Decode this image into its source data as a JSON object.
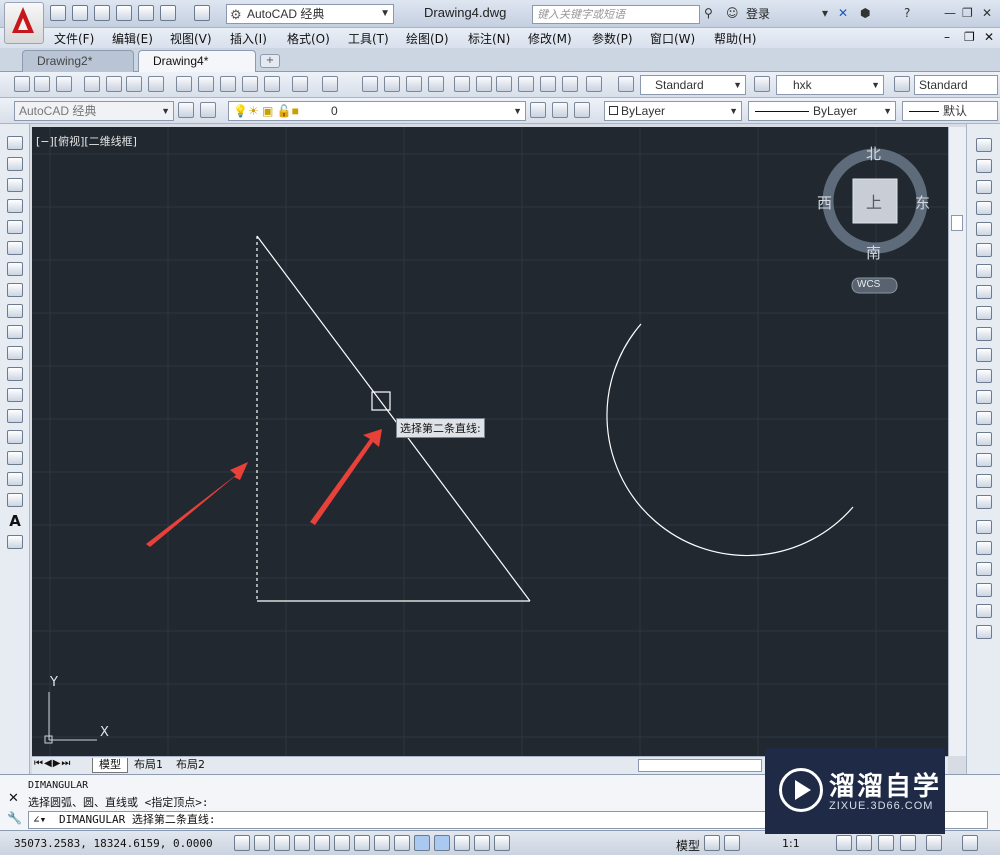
{
  "titlebar": {
    "workspace": "AutoCAD 经典",
    "document_title": "Drawing4.dwg",
    "search_placeholder": "键入关键字或短语",
    "login_label": "登录"
  },
  "menu": [
    "文件(F)",
    "编辑(E)",
    "视图(V)",
    "插入(I)",
    "格式(O)",
    "工具(T)",
    "绘图(D)",
    "标注(N)",
    "修改(M)",
    "参数(P)",
    "窗口(W)",
    "帮助(H)"
  ],
  "tabs": [
    "Drawing2*",
    "Drawing4*"
  ],
  "toolbar": {
    "text_style": "Standard",
    "dim_style": "hxk",
    "table_style": "Standard",
    "workspace2": "AutoCAD 经典",
    "layer": "0",
    "color": "ByLayer",
    "linetype": "ByLayer",
    "lineweight": "默认"
  },
  "viewport": {
    "label": "[−][俯视][二维线框]",
    "compass": {
      "north": "北",
      "south": "南",
      "east": "东",
      "west": "西",
      "center": "上"
    },
    "ucs_label": "WCS",
    "axis_y": "Y",
    "axis_x": "X",
    "tooltip": "选择第二条直线:"
  },
  "layout_tabs": [
    "模型",
    "布局1",
    "布局2"
  ],
  "command": {
    "history1": "DIMANGULAR",
    "history2": "选择圆弧、圆、直线或 <指定顶点>:",
    "prompt": "DIMANGULAR 选择第二条直线:"
  },
  "status": {
    "coords": "35073.2583, 18324.6159, 0.0000",
    "model_label": "模型",
    "scale": "1:1"
  },
  "watermark": {
    "title": "溜溜自学",
    "url": "ZIXUE.3D66.COM"
  },
  "colors": {
    "canvas": "#212830",
    "arrow": "#e8413a",
    "geometry": "#ffffff"
  }
}
